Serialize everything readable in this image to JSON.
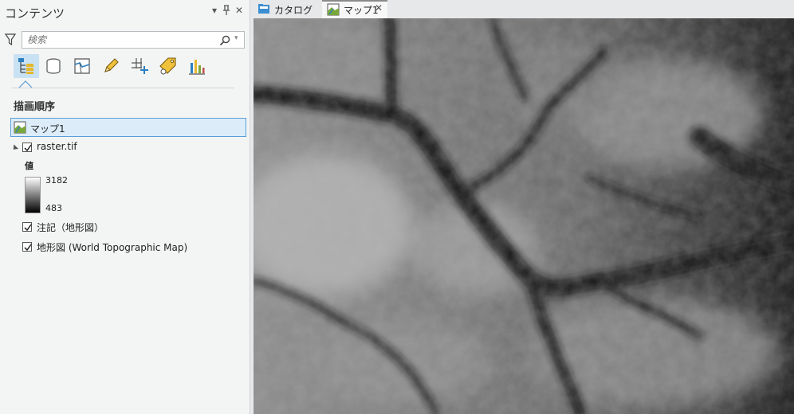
{
  "contents_pane": {
    "title": "コンテンツ",
    "controls": {
      "menu": "▾",
      "pin": "ꟼ",
      "close": "✕"
    },
    "search": {
      "placeholder": "検索"
    },
    "toolbar": [
      {
        "name": "list-by-drawing-order",
        "icon": "drawing-order-icon",
        "active": true
      },
      {
        "name": "list-by-data-source",
        "icon": "data-source-icon",
        "active": false
      },
      {
        "name": "list-by-selection",
        "icon": "selection-icon",
        "active": false
      },
      {
        "name": "list-by-editing",
        "icon": "pencil-icon",
        "active": false
      },
      {
        "name": "list-by-snapping",
        "icon": "snapping-icon",
        "active": false
      },
      {
        "name": "list-by-labeling",
        "icon": "label-tag-icon",
        "active": false
      },
      {
        "name": "list-by-charts",
        "icon": "chart-icon",
        "active": false
      }
    ],
    "section_title": "描画順序",
    "tree": {
      "map_name": "マップ1",
      "raster_layer": {
        "name": "raster.tif",
        "checked": true
      },
      "legend": {
        "field": "値",
        "high": "3182",
        "low": "483"
      },
      "annotation_layer": {
        "name": "注記（地形図）",
        "checked": true
      },
      "basemap_layer": {
        "name": "地形図 (World Topographic Map)",
        "checked": true
      }
    }
  },
  "tabs": [
    {
      "label": "カタログ",
      "icon": "catalog-icon",
      "active": false
    },
    {
      "label": "マップ1",
      "icon": "map-icon",
      "active": true,
      "close": "✕"
    }
  ],
  "colors": {
    "selection_fill": "#dcecf9",
    "selection_border": "#5aa0d8",
    "active_tool": "#c9e2f3"
  }
}
